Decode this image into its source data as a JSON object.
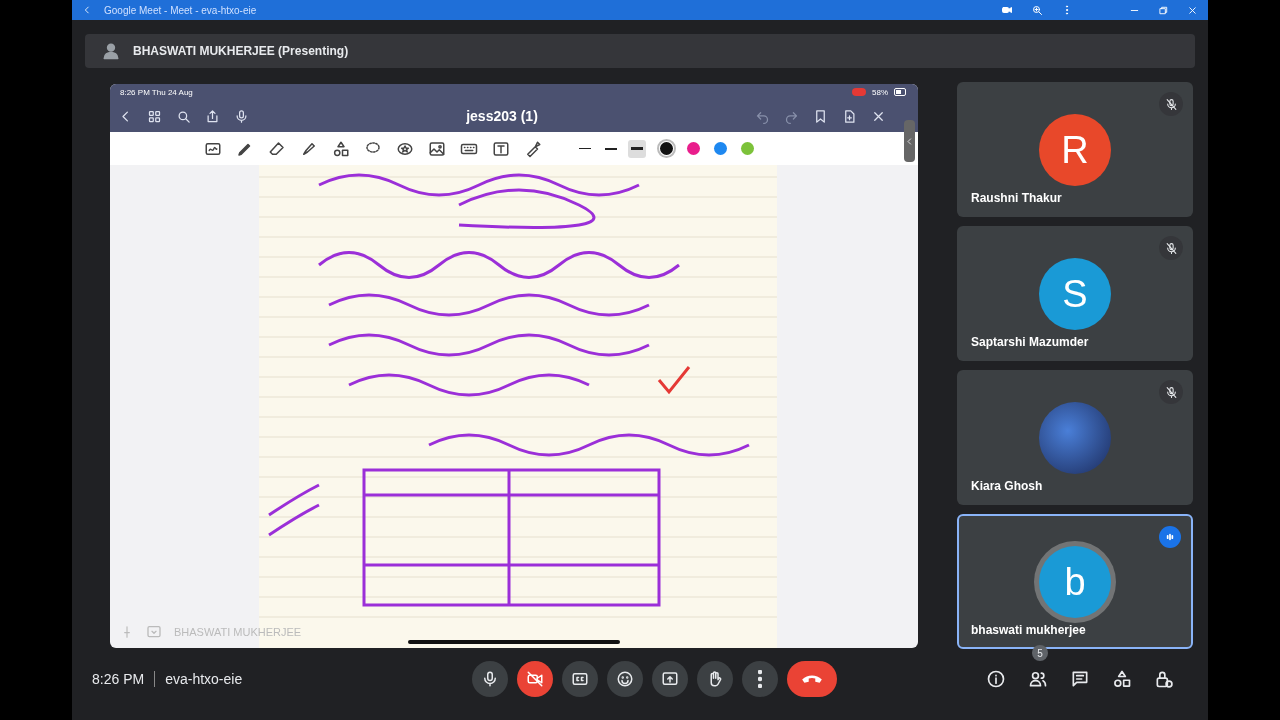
{
  "browser": {
    "tab_title": "Google Meet - Meet - eva-htxo-eie"
  },
  "presenter_bar": {
    "label": "BHASWATI MUKHERJEE (Presenting)"
  },
  "shared_screen": {
    "status_time": "8:26 PM  Thu 24 Aug",
    "battery": "58%",
    "document_title": "jess203 (1)",
    "footer_name": "BHASWATI MUKHERJEE",
    "stroke_widths": [
      {
        "selected": false
      },
      {
        "selected": false
      },
      {
        "selected": true
      }
    ],
    "pen_colors": [
      {
        "color": "#111111",
        "selected": true
      },
      {
        "color": "#e91e8c",
        "selected": false
      },
      {
        "color": "#1e88f0",
        "selected": false
      },
      {
        "color": "#7cc23a",
        "selected": false
      }
    ]
  },
  "participants": [
    {
      "name": "Raushni Thakur",
      "initial": "R",
      "kind": "initial",
      "color": "#e8482a",
      "muted": true,
      "speaking": false
    },
    {
      "name": "Saptarshi Mazumder",
      "initial": "S",
      "kind": "initial",
      "color": "#1a9ad6",
      "muted": true,
      "speaking": false
    },
    {
      "name": "Kiara Ghosh",
      "kind": "photo",
      "muted": true,
      "speaking": false
    },
    {
      "name": "bhaswati mukherjee",
      "initial": "b",
      "kind": "initial",
      "color": "#1a9ad6",
      "muted": false,
      "speaking": true
    }
  ],
  "bottom_bar": {
    "time": "8:26 PM",
    "meeting_code": "eva-htxo-eie",
    "mic_on": true,
    "camera_on": false,
    "participant_count": "5"
  }
}
